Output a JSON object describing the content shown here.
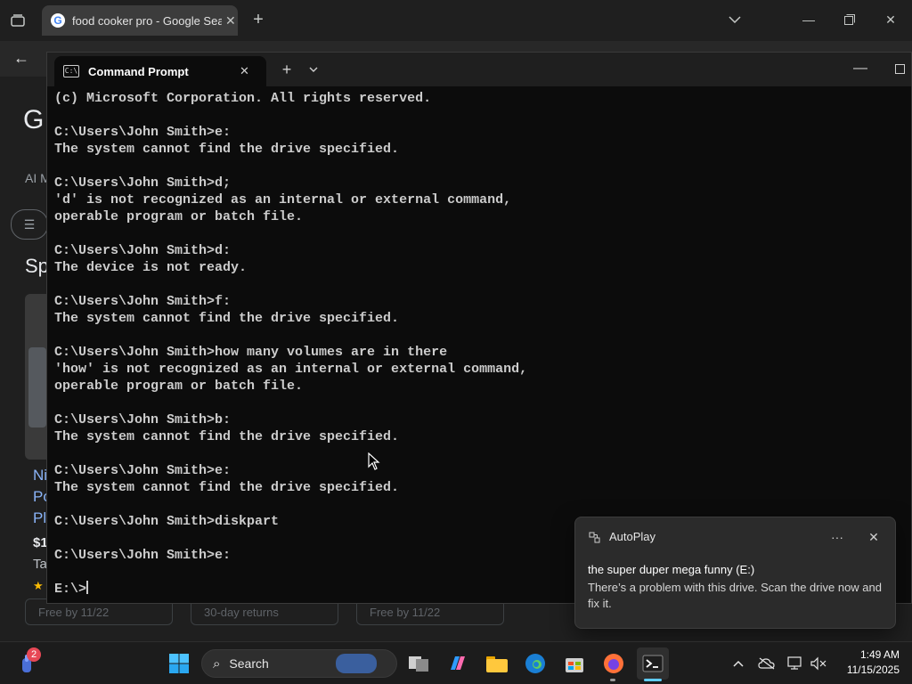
{
  "browser": {
    "tab_title": "food cooker pro - Google Searc",
    "tab_favicon": "G",
    "page_fragments": {
      "logo_letter": "G",
      "ai_mode": "AI M",
      "sponsored": "Sp",
      "product_lines": [
        "Ni",
        "Po",
        "Pl"
      ],
      "price": "$1",
      "ta": "Ta",
      "star": "★"
    },
    "shipping_chips": [
      "Free by 11/22",
      "30-day returns",
      "Free by 11/22"
    ]
  },
  "terminal": {
    "title": "Command Prompt",
    "lines": [
      "(c) Microsoft Corporation. All rights reserved.",
      "",
      "C:\\Users\\John Smith>e:",
      "The system cannot find the drive specified.",
      "",
      "C:\\Users\\John Smith>d;",
      "'d' is not recognized as an internal or external command,",
      "operable program or batch file.",
      "",
      "C:\\Users\\John Smith>d:",
      "The device is not ready.",
      "",
      "C:\\Users\\John Smith>f:",
      "The system cannot find the drive specified.",
      "",
      "C:\\Users\\John Smith>how many volumes are in there",
      "'how' is not recognized as an internal or external command,",
      "operable program or batch file.",
      "",
      "C:\\Users\\John Smith>b:",
      "The system cannot find the drive specified.",
      "",
      "C:\\Users\\John Smith>e:",
      "The system cannot find the drive specified.",
      "",
      "C:\\Users\\John Smith>diskpart",
      "",
      "C:\\Users\\John Smith>e:",
      ""
    ],
    "prompt": "E:\\>"
  },
  "toast": {
    "app_name": "AutoPlay",
    "more_label": "···",
    "title": "the super duper mega funny (E:)",
    "body": "There’s a problem with this drive.  Scan the drive now and fix it."
  },
  "taskbar": {
    "search_label": "Search",
    "widgets_badge": "2",
    "time": "1:49 AM",
    "date": "11/15/2025"
  },
  "colors": {
    "terminal_bg": "#0c0c0c",
    "terminal_text": "#cccccc",
    "accent": "#60cdff",
    "badge": "#e74856"
  }
}
